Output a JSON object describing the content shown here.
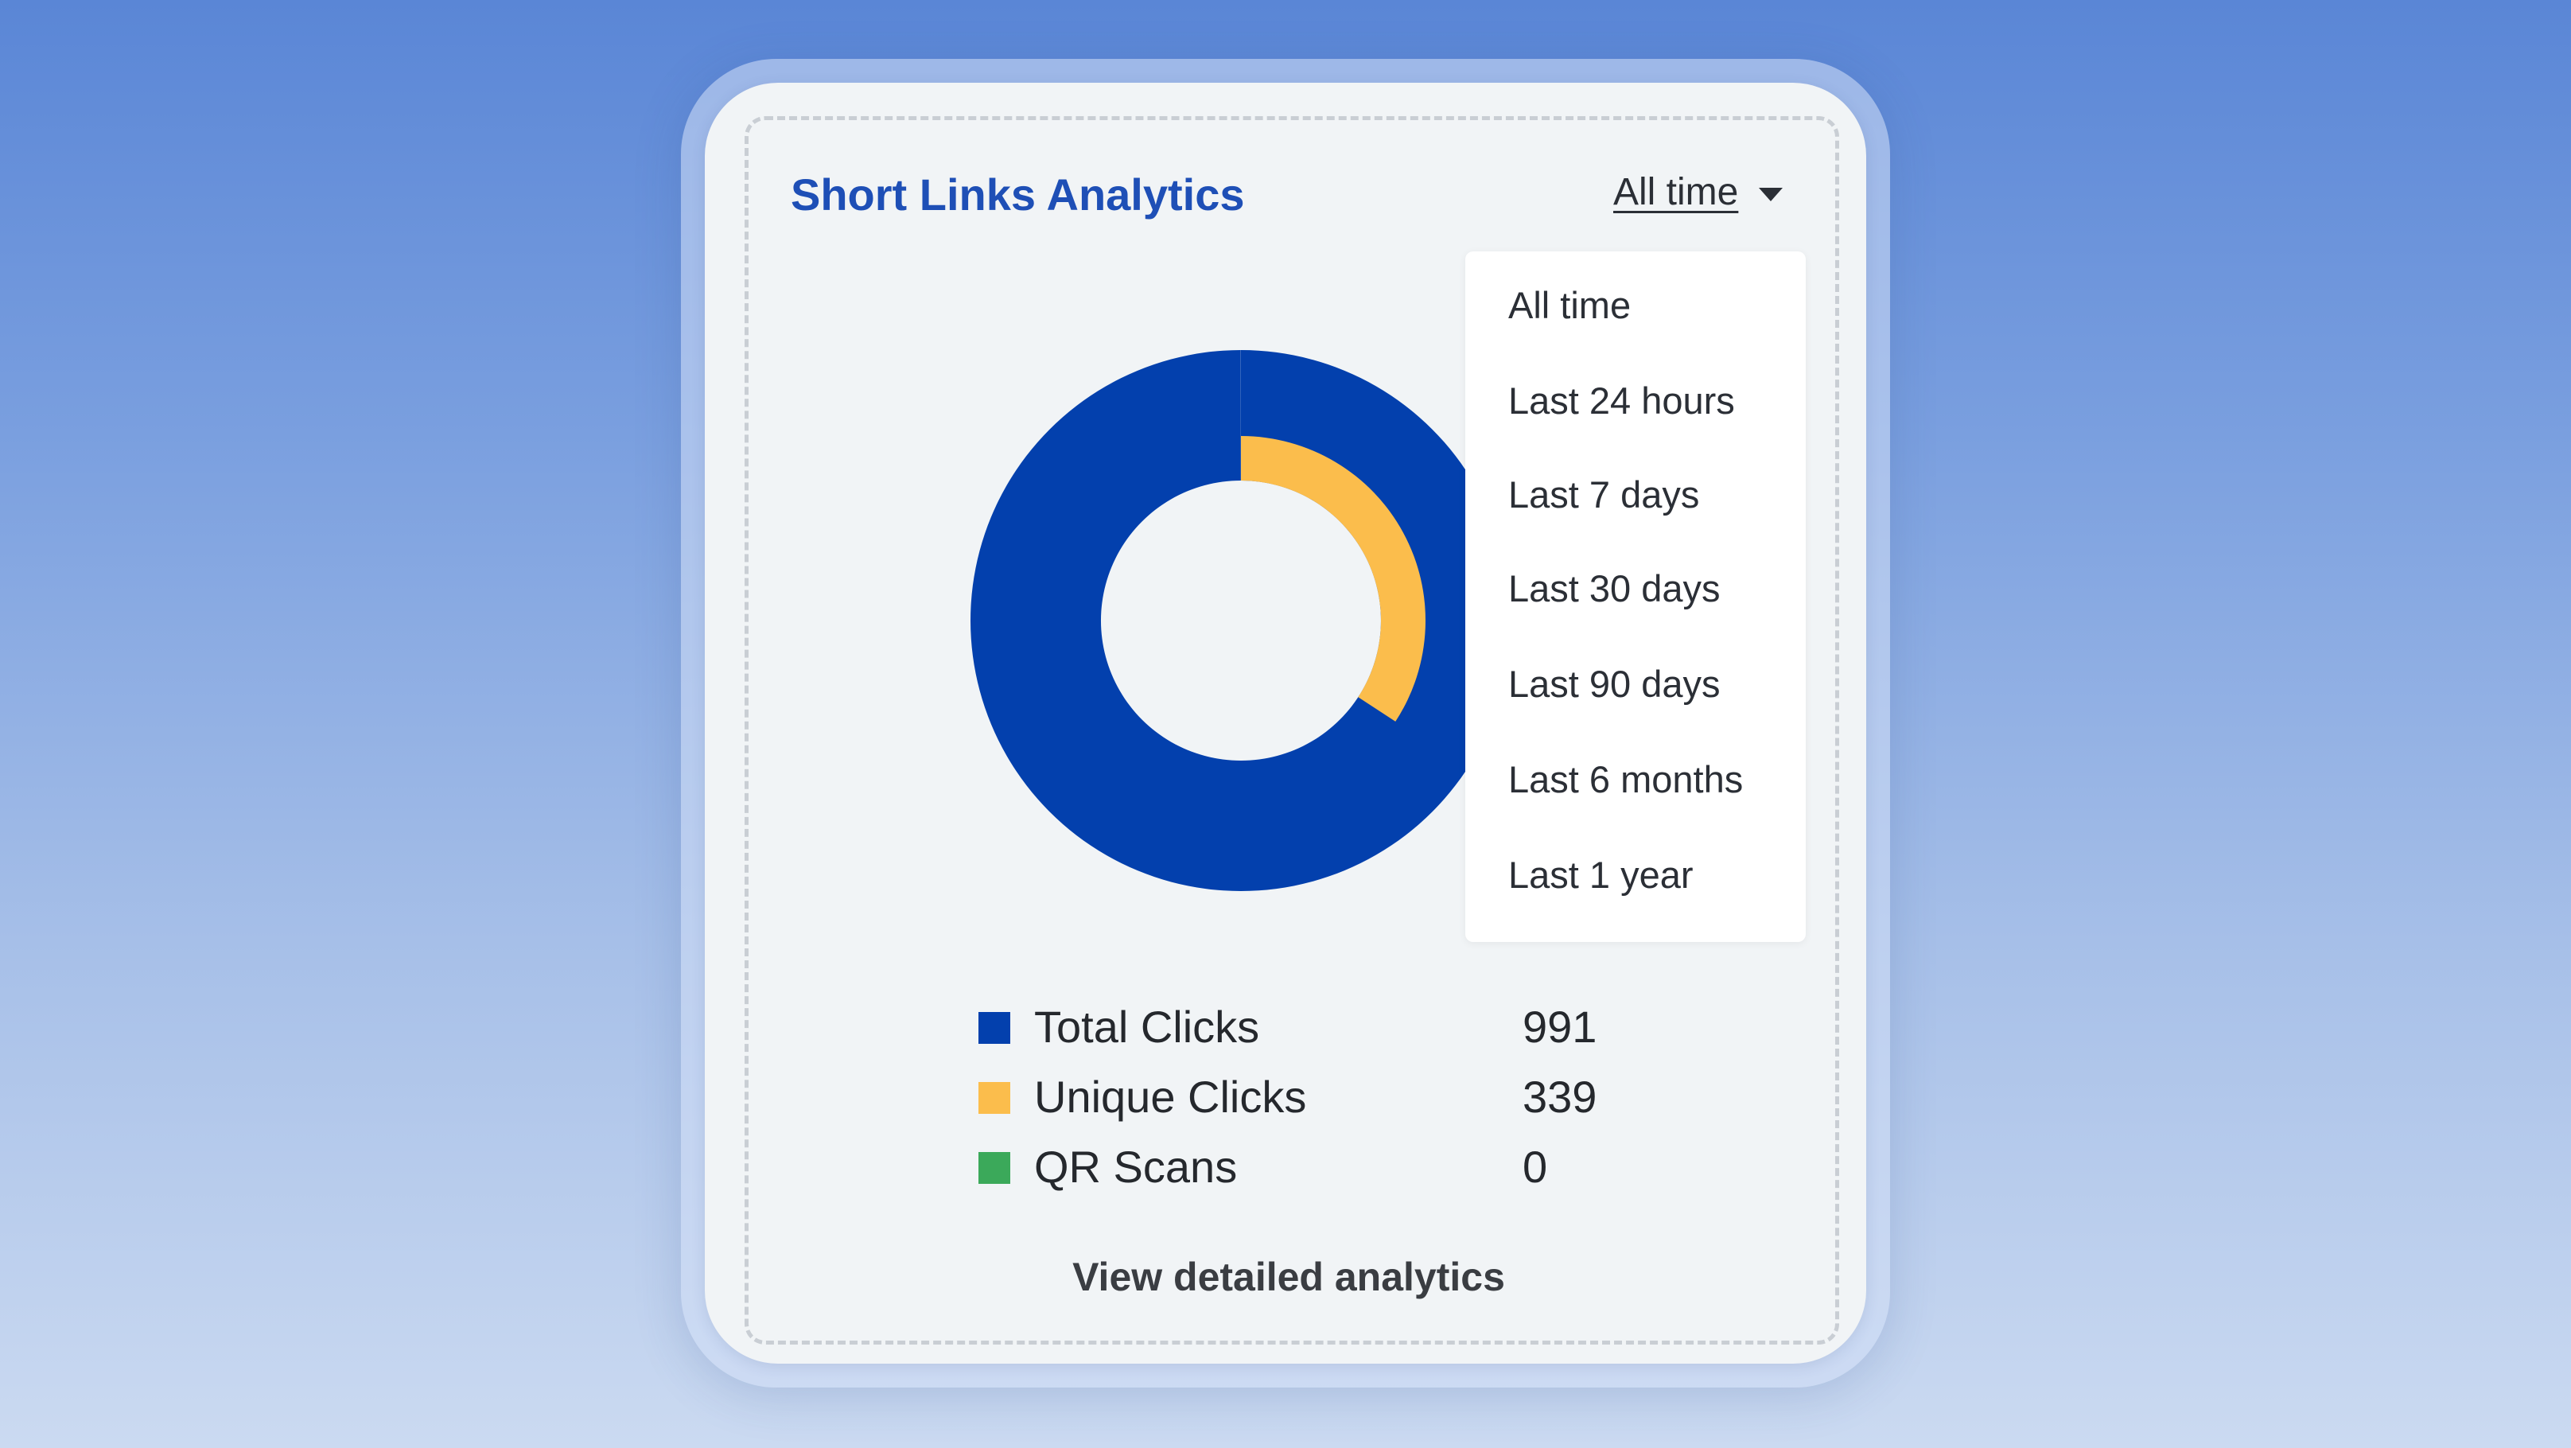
{
  "card": {
    "title": "Short Links Analytics",
    "view_link_label": "View detailed analytics"
  },
  "period": {
    "selected": "All time",
    "options": [
      "All time",
      "Last 24 hours",
      "Last 7 days",
      "Last 30 days",
      "Last 90 days",
      "Last 6 months",
      "Last 1 year"
    ]
  },
  "legend": [
    {
      "label": "Total Clicks",
      "value": "991",
      "color": "#0340ad"
    },
    {
      "label": "Unique Clicks",
      "value": "339",
      "color": "#fbbd4c"
    },
    {
      "label": "QR Scans",
      "value": "0",
      "color": "#3ba95a"
    }
  ],
  "icons": {
    "dropdown": "caret-down-icon"
  },
  "chart_data": {
    "type": "pie",
    "categories": [
      "Total Clicks",
      "Unique Clicks",
      "QR Scans"
    ],
    "values": [
      991,
      339,
      0
    ],
    "colors": [
      "#0340ad",
      "#fbbd4c",
      "#3ba95a"
    ],
    "title": ""
  }
}
